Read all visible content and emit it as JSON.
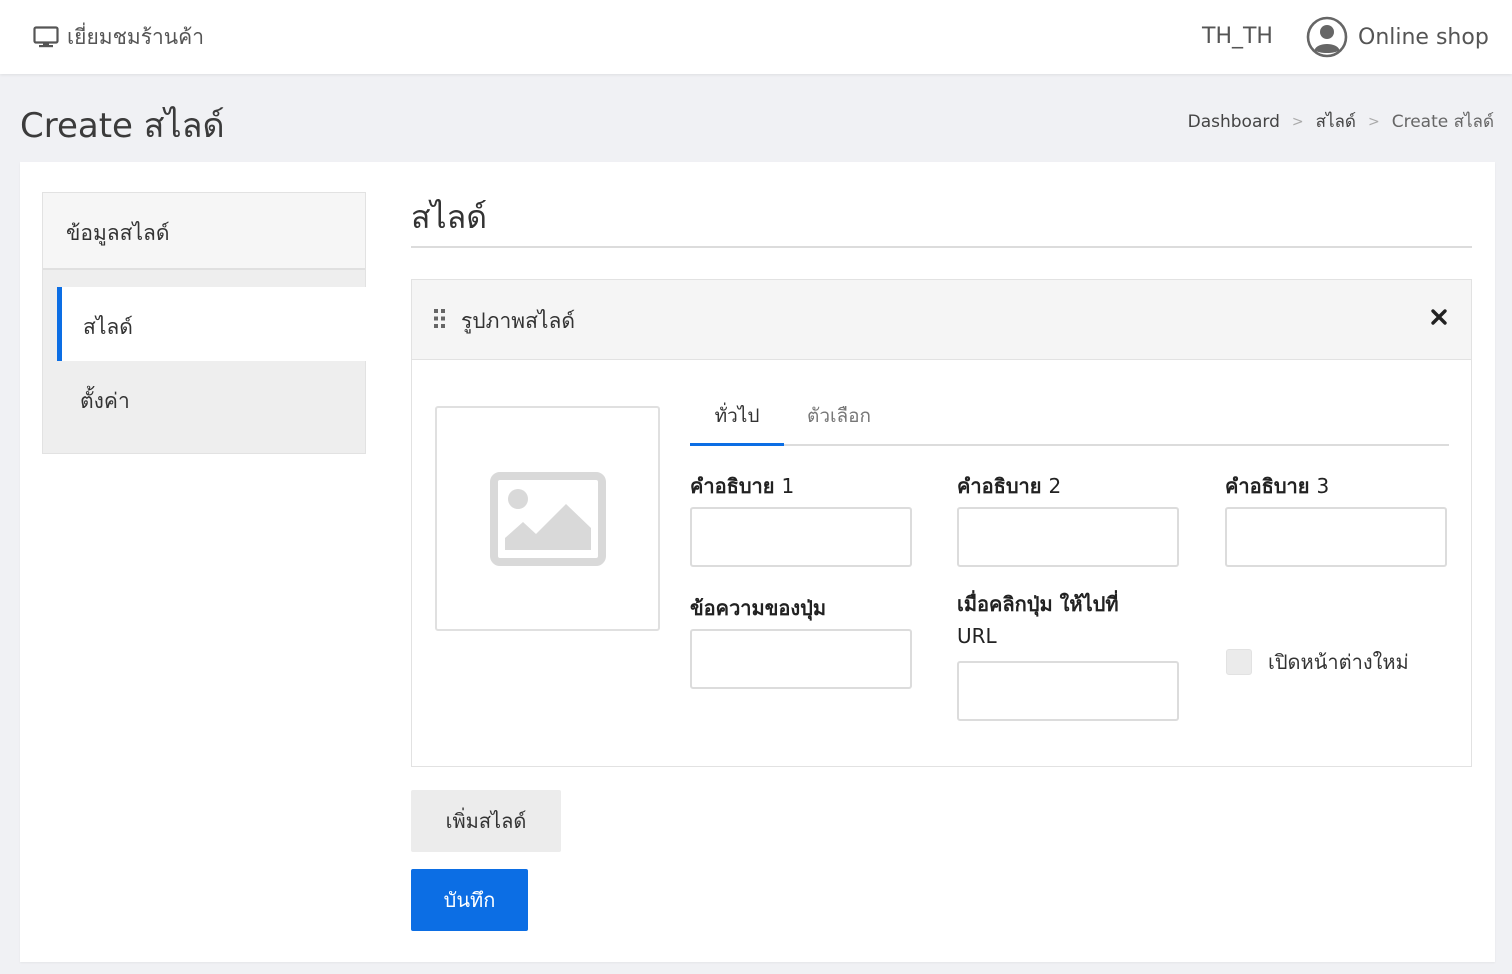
{
  "topbar": {
    "visit_shop_label": "เยี่ยมชมร้านค้า",
    "language": "TH_TH",
    "user_name": "Online shop"
  },
  "page": {
    "title": "Create สไลด์",
    "breadcrumb": [
      {
        "label": "Dashboard"
      },
      {
        "label": "สไลด์"
      },
      {
        "label": "Create สไลด์"
      }
    ],
    "breadcrumb_separator": ">"
  },
  "sidebar": {
    "header": "ข้อมูลสไลด์",
    "items": [
      {
        "label": "สไลด์",
        "active": true
      },
      {
        "label": "ตั้งค่า",
        "active": false
      }
    ]
  },
  "main": {
    "section_title": "สไลด์",
    "slide_panel": {
      "title": "รูปภาพสไลด์",
      "tabs": [
        {
          "label": "ทั่วไป",
          "active": true
        },
        {
          "label": "ตัวเลือก",
          "active": false
        }
      ],
      "fields": {
        "caption1": {
          "label": "คำอธิบาย",
          "num": "1",
          "value": ""
        },
        "caption2": {
          "label": "คำอธิบาย",
          "num": "2",
          "value": ""
        },
        "caption3": {
          "label": "คำอธิบาย",
          "num": "3",
          "value": ""
        },
        "button_text": {
          "label": "ข้อความของปุ่ม",
          "value": ""
        },
        "button_url": {
          "label_bold": "เมื่อคลิกปุ่ม ให้ไปที่",
          "label_suffix": "URL",
          "value": ""
        },
        "new_window": {
          "label": "เปิดหน้าต่างใหม่",
          "checked": false
        }
      }
    },
    "add_slide_label": "เพิ่มสไลด์",
    "save_label": "บันทึก"
  },
  "colors": {
    "accent": "#0c6ee4",
    "background": "#f0f1f4",
    "panel_header": "#f5f5f5"
  },
  "icons": {
    "visit_shop": "desktop-icon",
    "user": "user-circle-icon",
    "drag": "drag-handle-icon",
    "close": "close-icon",
    "image_placeholder": "image-placeholder-icon"
  }
}
